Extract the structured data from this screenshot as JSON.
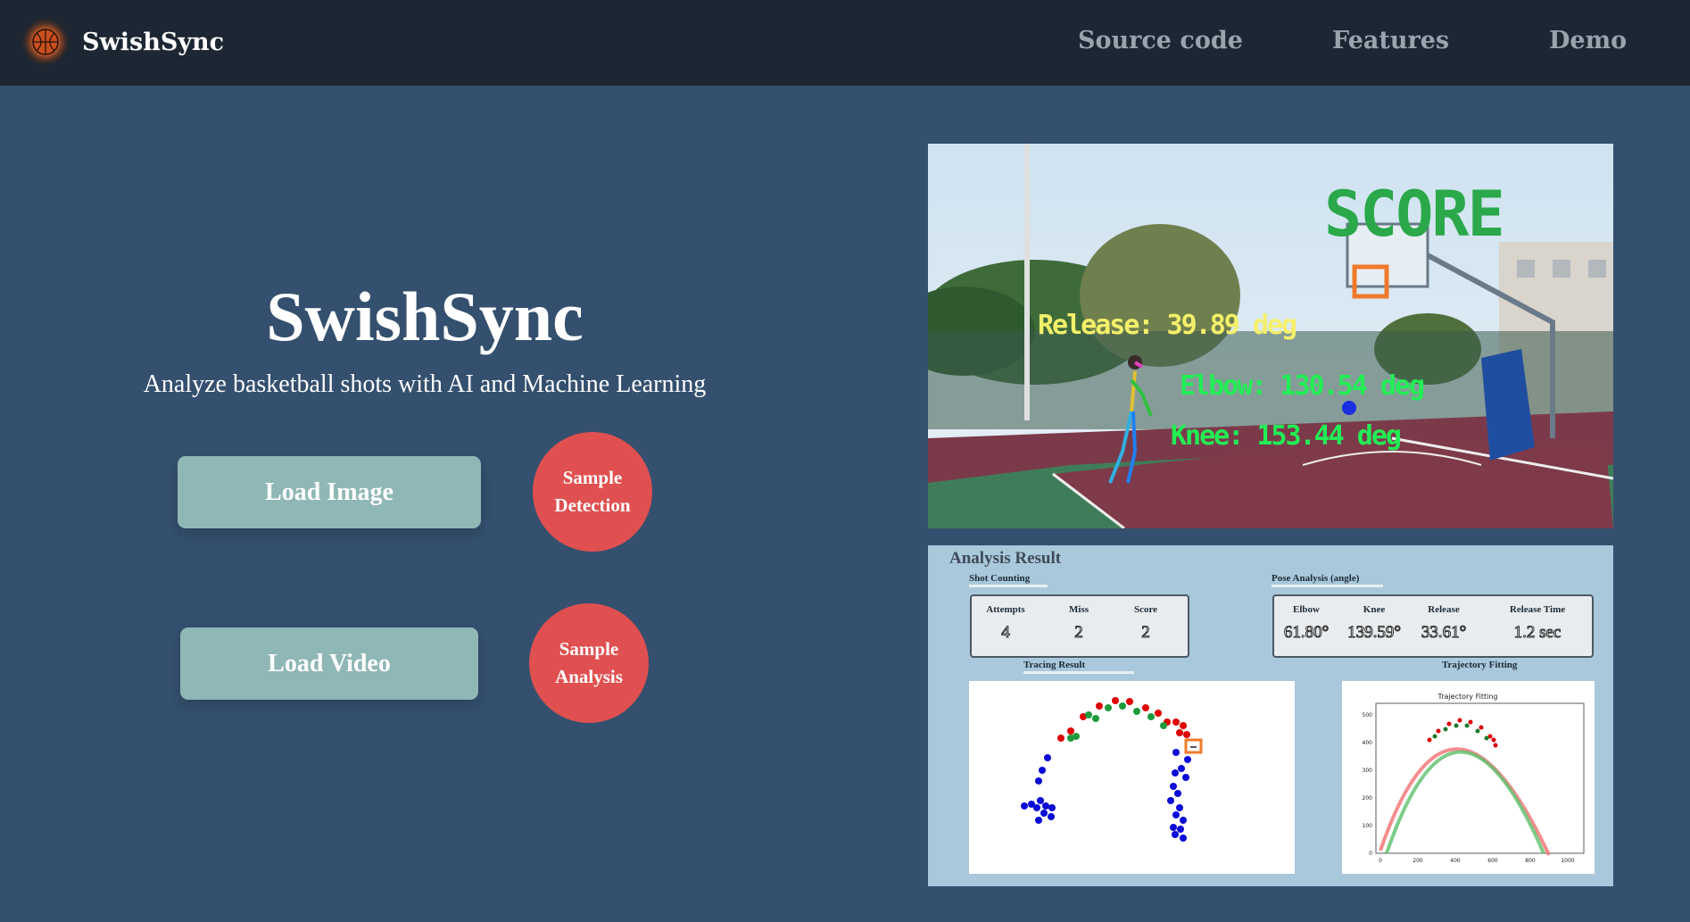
{
  "nav": {
    "brand": "SwishSync",
    "links": [
      "Source code",
      "Features",
      "Demo"
    ]
  },
  "hero": {
    "title": "SwishSync",
    "subtitle": "Analyze basketball shots with AI and Machine Learning",
    "load_image": "Load Image",
    "load_video": "Load Video",
    "sample_detection": [
      "Sample",
      "Detection"
    ],
    "sample_analysis": [
      "Sample",
      "Analysis"
    ]
  },
  "video": {
    "score_label": "SCORE",
    "release": "Release: 39.89 deg",
    "elbow": "Elbow: 130.54 deg",
    "knee": "Knee: 153.44 deg"
  },
  "analysis": {
    "title": "Analysis Result",
    "shot_counting": {
      "label": "Shot Counting",
      "columns": [
        "Attempts",
        "Miss",
        "Score"
      ],
      "values": [
        "4",
        "2",
        "2"
      ]
    },
    "pose": {
      "label": "Pose Analysis (angle)",
      "columns": [
        "Elbow",
        "Knee",
        "Release",
        "Release Time"
      ],
      "values": [
        "61.80°",
        "139.59°",
        "33.61°",
        "1.2 sec"
      ]
    },
    "tracing_label": "Tracing Result",
    "fitting_label": "Trajectory Fitting",
    "fitting_chart_title": "Trajectory Fitting",
    "fitting_y_ticks": [
      "0",
      "100",
      "200",
      "300",
      "400",
      "500"
    ],
    "fitting_x_ticks": [
      "0",
      "200",
      "400",
      "600",
      "800",
      "1000"
    ]
  },
  "colors": {
    "background": "#34506e",
    "nav": "#1c2733",
    "button": "#8fb7b5",
    "circle_button": "#e05050",
    "panel": "#a9c8dc",
    "score_green": "#2aa84a",
    "release_yellow": "#f4f06a",
    "angle_green": "#22ee55"
  }
}
